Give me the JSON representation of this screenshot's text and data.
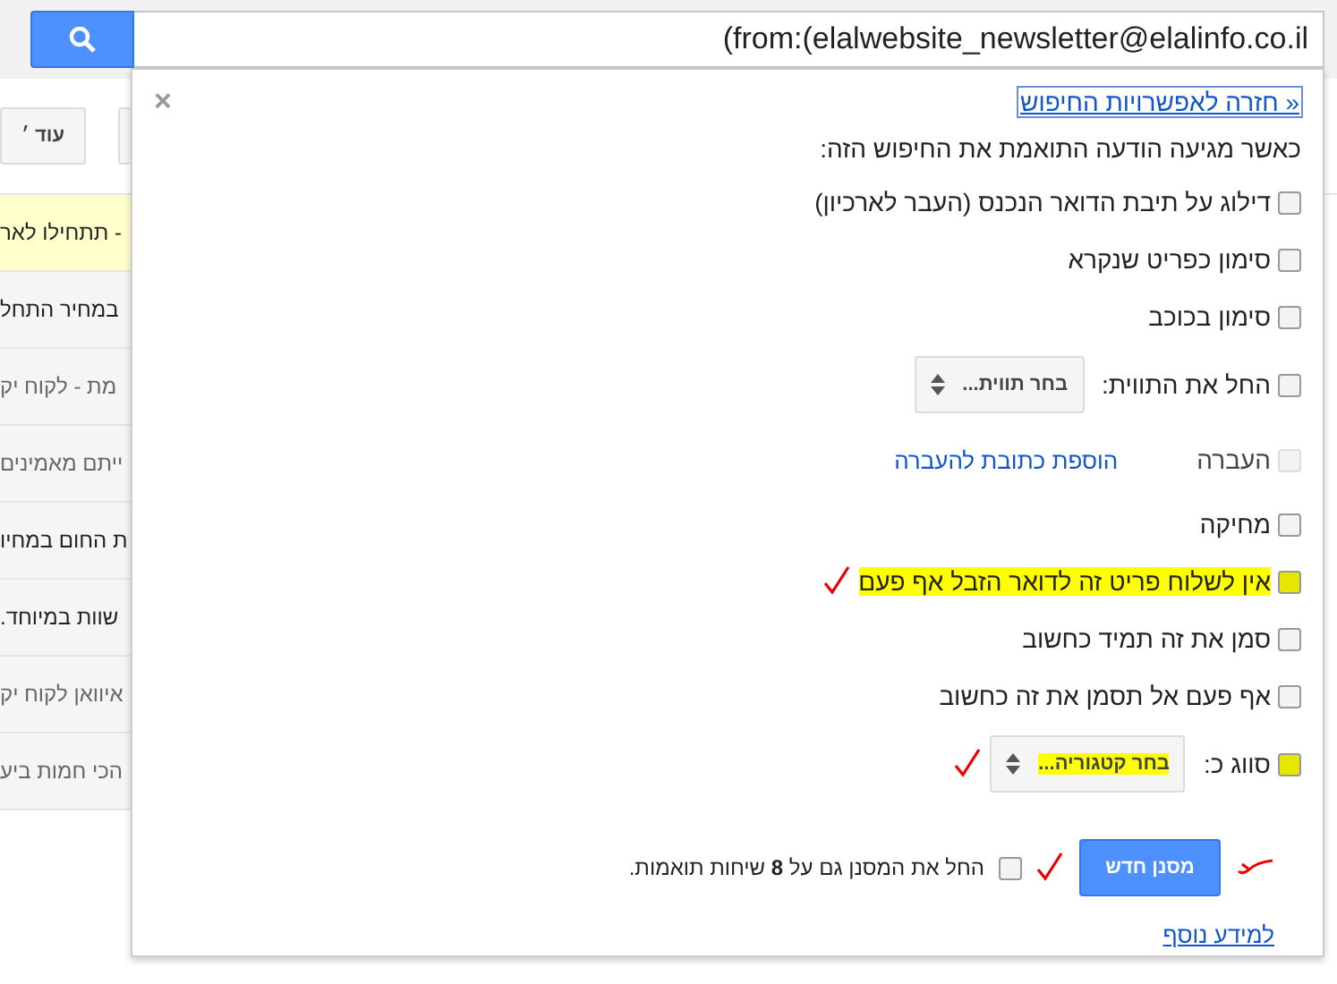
{
  "search": {
    "value": "(from:(elalwebsite_newsletter@elalinfo.co.il"
  },
  "toolbar": {
    "buttons": [
      {
        "label": "עוד ׳"
      },
      {
        "kind": "blank"
      }
    ]
  },
  "messages": [
    {
      "text": "- תתחילו לאר",
      "unread": true,
      "highlighted": true
    },
    {
      "text": "במחיר התחל",
      "unread": true,
      "highlighted": false
    },
    {
      "text": "מת - לקוח יק",
      "unread": false,
      "highlighted": false
    },
    {
      "text": "ייתם מאמינים",
      "unread": false,
      "highlighted": false
    },
    {
      "text": "ת החום במחיו",
      "unread": true,
      "highlighted": false
    },
    {
      "text": "שוות במיוחד.",
      "unread": true,
      "highlighted": false
    },
    {
      "text": "איוואן לקוח יק",
      "unread": false,
      "highlighted": false
    },
    {
      "text": "הכי חמות ביע",
      "unread": false,
      "highlighted": false
    }
  ],
  "filter_panel": {
    "back_link": "« חזרה לאפשרויות החיפוש",
    "close": "×",
    "heading": "כאשר מגיעה הודעה התואמת את החיפוש הזה:",
    "options": [
      {
        "kind": "check",
        "label": "דילוג על תיבת הדואר הנכנס (העבר לארכיון)",
        "checked": false,
        "disabled": false,
        "highlighted": false,
        "annotated": false
      },
      {
        "kind": "check",
        "label": "סימון כפריט שנקרא",
        "checked": false,
        "disabled": false,
        "highlighted": false,
        "annotated": false
      },
      {
        "kind": "check",
        "label": "סימון בכוכב",
        "checked": false,
        "disabled": false,
        "highlighted": false,
        "annotated": false
      },
      {
        "kind": "select",
        "label": "החל את התווית:",
        "select": "בחר תווית...",
        "checked": false,
        "disabled": false,
        "highlighted": false,
        "annotated": false
      },
      {
        "kind": "link",
        "label": "העברה",
        "link": "הוספת כתובת להעברה",
        "checked": false,
        "disabled": true,
        "highlighted": false,
        "annotated": false
      },
      {
        "kind": "check",
        "label": "מחיקה",
        "checked": false,
        "disabled": false,
        "highlighted": false,
        "annotated": false
      },
      {
        "kind": "check",
        "label": "אין לשלוח פריט זה לדואר הזבל אף פעם",
        "checked": false,
        "disabled": false,
        "highlighted": true,
        "annotated": true
      },
      {
        "kind": "check",
        "label": "סמן את זה תמיד כחשוב",
        "checked": false,
        "disabled": false,
        "highlighted": false,
        "annotated": false
      },
      {
        "kind": "check",
        "label": "אף פעם אל תסמן את זה כחשוב",
        "checked": false,
        "disabled": false,
        "highlighted": false,
        "annotated": false
      },
      {
        "kind": "select",
        "label": "סווג כ:",
        "select": "בחר קטגוריה...",
        "checked": false,
        "disabled": false,
        "highlighted": true,
        "annotated": true
      }
    ],
    "create_button": {
      "label": "מסנן חדש",
      "annotated": true
    },
    "apply_also": {
      "label": "החל את המסנן גם על **8** שיחות תואמות.",
      "checked": false,
      "annotated": true
    },
    "more_info": "למידע נוסף"
  }
}
